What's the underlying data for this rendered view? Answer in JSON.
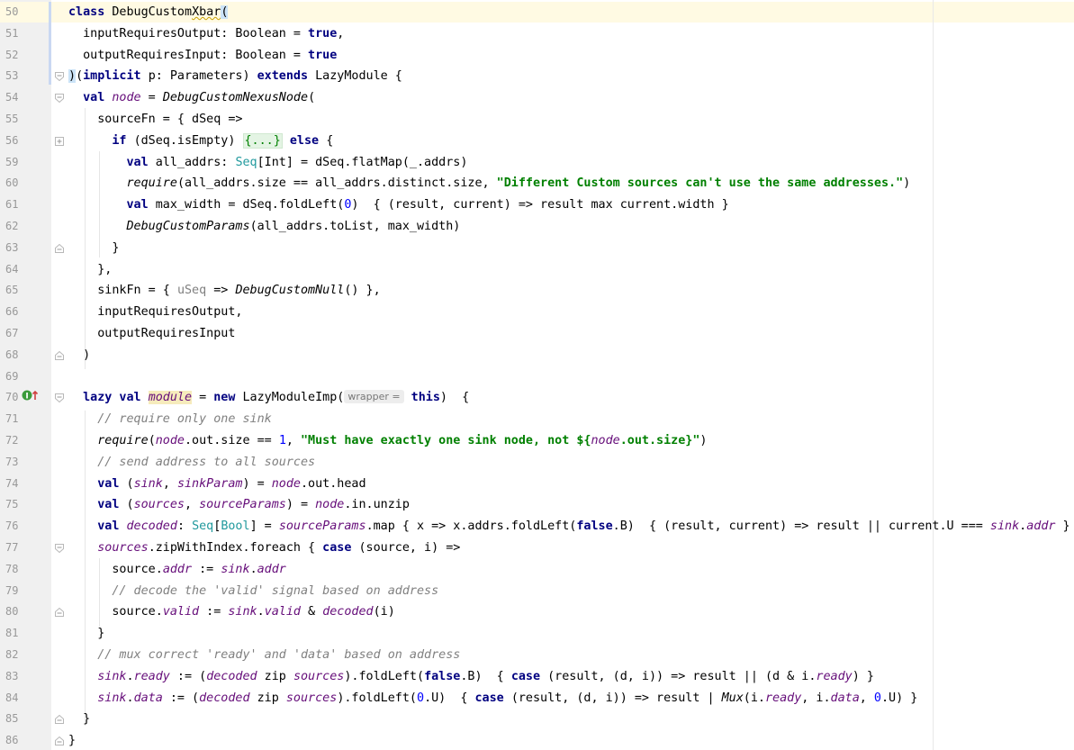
{
  "editor": {
    "language": "Scala",
    "lines": [
      {
        "n": "50",
        "current": true,
        "segs": [
          [
            "class ",
            "kw"
          ],
          [
            "DebugCustom",
            ""
          ],
          [
            "Xbar",
            "squig"
          ],
          [
            "(",
            "bracket-hl"
          ]
        ]
      },
      {
        "n": "51",
        "segs": [
          [
            "  inputRequiresOutput: Boolean = ",
            ""
          ],
          [
            "true",
            "kw"
          ],
          [
            ",",
            ""
          ]
        ]
      },
      {
        "n": "52",
        "segs": [
          [
            "  outputRequiresInput: Boolean = ",
            ""
          ],
          [
            "true",
            "kw"
          ]
        ]
      },
      {
        "n": "53",
        "segs": [
          [
            ")",
            "bracket-hl"
          ],
          [
            "(",
            ""
          ],
          [
            "implicit ",
            "kw"
          ],
          [
            "p: Parameters) ",
            ""
          ],
          [
            "extends ",
            "kw"
          ],
          [
            "LazyModule {",
            ""
          ]
        ]
      },
      {
        "n": "54",
        "segs": [
          [
            "  ",
            ""
          ],
          [
            "val ",
            "kw"
          ],
          [
            "node",
            "fld"
          ],
          [
            " = ",
            ""
          ],
          [
            "DebugCustomNexusNode",
            "it"
          ],
          [
            "(",
            ""
          ]
        ]
      },
      {
        "n": "55",
        "segs": [
          [
            "    sourceFn = { dSeq =>",
            ""
          ]
        ]
      },
      {
        "n": "56",
        "segs": [
          [
            "      ",
            ""
          ],
          [
            "if ",
            "kw"
          ],
          [
            "(dSeq.isEmpty) ",
            ""
          ],
          [
            "{...}",
            "fold"
          ],
          [
            " ",
            ""
          ],
          [
            "else ",
            "kw"
          ],
          [
            "{",
            ""
          ]
        ]
      },
      {
        "n": "59",
        "segs": [
          [
            "        ",
            ""
          ],
          [
            "val ",
            "kw"
          ],
          [
            "all_addrs: ",
            ""
          ],
          [
            "Seq",
            "typ"
          ],
          [
            "[Int] = dSeq.flatMap(_.addrs)",
            ""
          ]
        ]
      },
      {
        "n": "60",
        "segs": [
          [
            "        ",
            ""
          ],
          [
            "require",
            "it"
          ],
          [
            "(all_addrs.size == all_addrs.distinct.size, ",
            ""
          ],
          [
            "\"Different Custom sources can't use the same addresses.\"",
            "str"
          ],
          [
            ")",
            ""
          ]
        ]
      },
      {
        "n": "61",
        "segs": [
          [
            "        ",
            ""
          ],
          [
            "val ",
            "kw"
          ],
          [
            "max_width = dSeq.foldLeft(",
            ""
          ],
          [
            "0",
            "num"
          ],
          [
            ")  { (result, current) => result max current.width }",
            ""
          ]
        ]
      },
      {
        "n": "62",
        "segs": [
          [
            "        ",
            ""
          ],
          [
            "DebugCustomParams",
            "it"
          ],
          [
            "(all_addrs.toList, max_width)",
            ""
          ]
        ]
      },
      {
        "n": "63",
        "segs": [
          [
            "      }",
            ""
          ]
        ]
      },
      {
        "n": "64",
        "segs": [
          [
            "    },",
            ""
          ]
        ]
      },
      {
        "n": "65",
        "segs": [
          [
            "    sinkFn = { ",
            ""
          ],
          [
            "uSeq",
            "unused"
          ],
          [
            " => ",
            ""
          ],
          [
            "DebugCustomNull",
            "it"
          ],
          [
            "() },",
            ""
          ]
        ]
      },
      {
        "n": "66",
        "segs": [
          [
            "    inputRequiresOutput,",
            ""
          ]
        ]
      },
      {
        "n": "67",
        "segs": [
          [
            "    outputRequiresInput",
            ""
          ]
        ]
      },
      {
        "n": "68",
        "segs": [
          [
            "  )",
            ""
          ]
        ]
      },
      {
        "n": "69",
        "segs": []
      },
      {
        "n": "70",
        "segs": [
          [
            "  ",
            ""
          ],
          [
            "lazy val ",
            "kw"
          ],
          [
            "module",
            "sel"
          ],
          [
            " = ",
            ""
          ],
          [
            "new ",
            "kw"
          ],
          [
            "LazyModuleImp(",
            ""
          ],
          [
            "HINT",
            "hint"
          ],
          [
            " ",
            ""
          ],
          [
            "this",
            "kw"
          ],
          [
            ")  {",
            ""
          ]
        ]
      },
      {
        "n": "71",
        "segs": [
          [
            "    ",
            ""
          ],
          [
            "// require only one sink",
            "cmt"
          ]
        ]
      },
      {
        "n": "72",
        "segs": [
          [
            "    ",
            ""
          ],
          [
            "require",
            "it"
          ],
          [
            "(",
            ""
          ],
          [
            "node",
            "fld"
          ],
          [
            ".out.size == ",
            ""
          ],
          [
            "1",
            "num"
          ],
          [
            ", ",
            ""
          ],
          [
            "\"Must have exactly one sink node, not ${",
            "str"
          ],
          [
            "node",
            "fld"
          ],
          [
            ".out.size}\"",
            "str"
          ],
          [
            ")",
            ""
          ]
        ]
      },
      {
        "n": "73",
        "segs": [
          [
            "    ",
            ""
          ],
          [
            "// send address to all sources",
            "cmt"
          ]
        ]
      },
      {
        "n": "74",
        "segs": [
          [
            "    ",
            ""
          ],
          [
            "val ",
            "kw"
          ],
          [
            "(",
            ""
          ],
          [
            "sink",
            "fld"
          ],
          [
            ", ",
            ""
          ],
          [
            "sinkParam",
            "fld"
          ],
          [
            ") = ",
            ""
          ],
          [
            "node",
            "fld"
          ],
          [
            ".out.head",
            ""
          ]
        ]
      },
      {
        "n": "75",
        "segs": [
          [
            "    ",
            ""
          ],
          [
            "val ",
            "kw"
          ],
          [
            "(",
            ""
          ],
          [
            "sources",
            "fld"
          ],
          [
            ", ",
            ""
          ],
          [
            "sourceParams",
            "fld"
          ],
          [
            ") = ",
            ""
          ],
          [
            "node",
            "fld"
          ],
          [
            ".in.unzip",
            ""
          ]
        ]
      },
      {
        "n": "76",
        "segs": [
          [
            "    ",
            ""
          ],
          [
            "val ",
            "kw"
          ],
          [
            "decoded",
            "fld"
          ],
          [
            ": ",
            ""
          ],
          [
            "Seq",
            "typ"
          ],
          [
            "[",
            ""
          ],
          [
            "Bool",
            "typ"
          ],
          [
            "] = ",
            ""
          ],
          [
            "sourceParams",
            "fld"
          ],
          [
            ".map { x => x.addrs.foldLeft(",
            ""
          ],
          [
            "false",
            "kw"
          ],
          [
            ".B)  { (result, current) => result || current.U === ",
            ""
          ],
          [
            "sink",
            "fld"
          ],
          [
            ".",
            ""
          ],
          [
            "addr",
            "fld"
          ],
          [
            " } }",
            ""
          ]
        ]
      },
      {
        "n": "77",
        "segs": [
          [
            "    ",
            ""
          ],
          [
            "sources",
            "fld"
          ],
          [
            ".zipWithIndex.foreach { ",
            ""
          ],
          [
            "case ",
            "kw"
          ],
          [
            "(source, i) =>",
            ""
          ]
        ]
      },
      {
        "n": "78",
        "segs": [
          [
            "      source.",
            ""
          ],
          [
            "addr",
            "fld"
          ],
          [
            " := ",
            ""
          ],
          [
            "sink",
            "fld"
          ],
          [
            ".",
            ""
          ],
          [
            "addr",
            "fld"
          ]
        ]
      },
      {
        "n": "79",
        "segs": [
          [
            "      ",
            ""
          ],
          [
            "// decode the 'valid' signal based on address",
            "cmt"
          ]
        ]
      },
      {
        "n": "80",
        "segs": [
          [
            "      source.",
            ""
          ],
          [
            "valid",
            "fld"
          ],
          [
            " := ",
            ""
          ],
          [
            "sink",
            "fld"
          ],
          [
            ".",
            ""
          ],
          [
            "valid",
            "fld"
          ],
          [
            " & ",
            ""
          ],
          [
            "decoded",
            "fld"
          ],
          [
            "(i)",
            ""
          ]
        ]
      },
      {
        "n": "81",
        "segs": [
          [
            "    }",
            ""
          ]
        ]
      },
      {
        "n": "82",
        "segs": [
          [
            "    ",
            ""
          ],
          [
            "// mux correct 'ready' and 'data' based on address",
            "cmt"
          ]
        ]
      },
      {
        "n": "83",
        "segs": [
          [
            "    ",
            ""
          ],
          [
            "sink",
            "fld"
          ],
          [
            ".",
            ""
          ],
          [
            "ready",
            "fld"
          ],
          [
            " := (",
            ""
          ],
          [
            "decoded",
            "fld"
          ],
          [
            " zip ",
            ""
          ],
          [
            "sources",
            "fld"
          ],
          [
            ").foldLeft(",
            ""
          ],
          [
            "false",
            "kw"
          ],
          [
            ".B)  { ",
            ""
          ],
          [
            "case ",
            "kw"
          ],
          [
            "(result, (d, i)) => result || (d & i.",
            ""
          ],
          [
            "ready",
            "fld"
          ],
          [
            ") }",
            ""
          ]
        ]
      },
      {
        "n": "84",
        "segs": [
          [
            "    ",
            ""
          ],
          [
            "sink",
            "fld"
          ],
          [
            ".",
            ""
          ],
          [
            "data",
            "fld"
          ],
          [
            " := (",
            ""
          ],
          [
            "decoded",
            "fld"
          ],
          [
            " zip ",
            ""
          ],
          [
            "sources",
            "fld"
          ],
          [
            ").foldLeft(",
            ""
          ],
          [
            "0",
            "num"
          ],
          [
            ".U)  { ",
            ""
          ],
          [
            "case ",
            "kw"
          ],
          [
            "(result, (d, i)) => result | ",
            ""
          ],
          [
            "Mux",
            "it"
          ],
          [
            "(i.",
            ""
          ],
          [
            "ready",
            "fld"
          ],
          [
            ", i.",
            ""
          ],
          [
            "data",
            "fld"
          ],
          [
            ", ",
            ""
          ],
          [
            "0",
            "num"
          ],
          [
            ".U) }",
            ""
          ]
        ]
      },
      {
        "n": "85",
        "segs": [
          [
            "  }",
            ""
          ]
        ]
      },
      {
        "n": "86",
        "segs": [
          [
            "}",
            ""
          ]
        ]
      }
    ],
    "param_hint": "wrapper =",
    "gutter_icons": {
      "line70": "implements-method-icon"
    },
    "colors": {
      "keyword": "#000080",
      "string": "#008000",
      "comment": "#808080",
      "field": "#660e7a",
      "number": "#0000ff",
      "type": "#20999d",
      "current_line": "#fffae3",
      "gutter": "#f0f0f0"
    }
  }
}
